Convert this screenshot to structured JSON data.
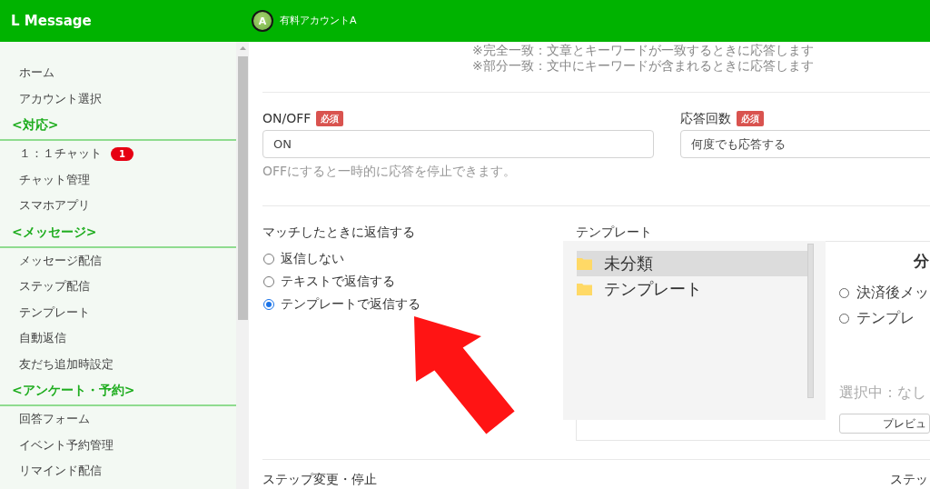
{
  "header": {
    "brand": "L Message",
    "avatar_letter": "A",
    "account": "有料アカウントA"
  },
  "sidebar": {
    "items": [
      {
        "kind": "link",
        "label": "ホーム"
      },
      {
        "kind": "link",
        "label": "アカウント選択"
      },
      {
        "kind": "heading",
        "label": "<対応>"
      },
      {
        "kind": "link",
        "label": "１：１チャット",
        "badge": "1"
      },
      {
        "kind": "link",
        "label": "チャット管理"
      },
      {
        "kind": "link",
        "label": "スマホアプリ"
      },
      {
        "kind": "heading",
        "label": "<メッセージ>"
      },
      {
        "kind": "link",
        "label": "メッセージ配信"
      },
      {
        "kind": "link",
        "label": "ステップ配信"
      },
      {
        "kind": "link",
        "label": "テンプレート"
      },
      {
        "kind": "link",
        "label": "自動返信"
      },
      {
        "kind": "link",
        "label": "友だち追加時設定"
      },
      {
        "kind": "heading",
        "label": "<アンケート・予約>"
      },
      {
        "kind": "link",
        "label": "回答フォーム"
      },
      {
        "kind": "link",
        "label": "イベント予約管理"
      },
      {
        "kind": "link",
        "label": "リマインド配信"
      }
    ]
  },
  "keyword_notes": [
    "※完全一致：文章とキーワードが一致するときに応答します",
    "※部分一致：文中にキーワードが含まれるときに応答します"
  ],
  "fields": [
    {
      "label": "ON/OFF",
      "badge": "必須",
      "value": "ON",
      "help": "OFFにすると一時的に応答を停止できます。"
    },
    {
      "label": "応答回数",
      "badge": "必須",
      "value": "何度でも応答する"
    }
  ],
  "reply_on_match": {
    "label": "マッチしたときに返信する",
    "options": [
      {
        "label": "返信しない",
        "selected": false
      },
      {
        "label": "テキストで返信する",
        "selected": false
      },
      {
        "label": "テンプレートで返信する",
        "selected": true
      }
    ]
  },
  "template": {
    "label": "テンプレート",
    "folders": [
      {
        "name": "未分類",
        "selected": true
      },
      {
        "name": "テンプレート",
        "selected": false
      }
    ],
    "column_heading": "分",
    "options": [
      {
        "label": "決済後メッ",
        "selected": false
      },
      {
        "label": "テンプレ",
        "selected": false
      }
    ],
    "selection": "選択中：なし",
    "preview_button": "プレビュ"
  },
  "bottom_labels": [
    "ステップ変更・停止",
    "ステッ"
  ]
}
